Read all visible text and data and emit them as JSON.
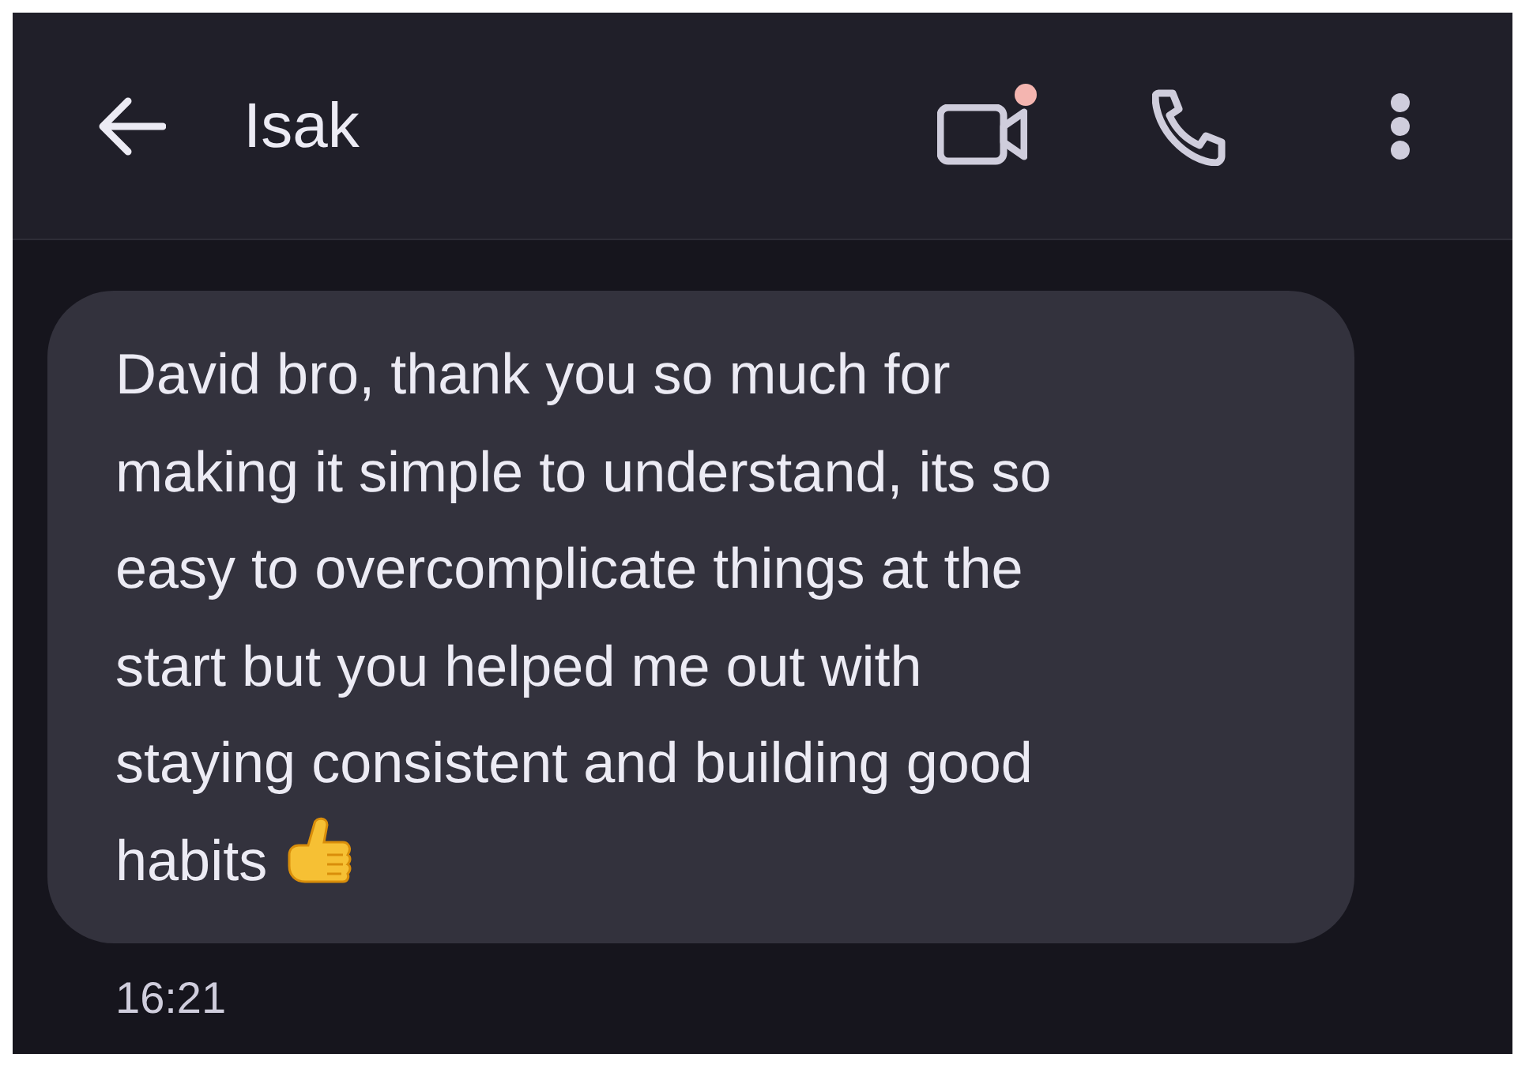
{
  "header": {
    "title": "Isak",
    "video_call_badge": true
  },
  "messages": [
    {
      "lines": [
        "David bro, thank you so much for",
        "making it simple to understand, its so",
        "easy to overcomplicate things at the",
        "start but you helped me out with",
        "staying consistent and building good",
        "habits"
      ],
      "time": "16:21"
    }
  ]
}
